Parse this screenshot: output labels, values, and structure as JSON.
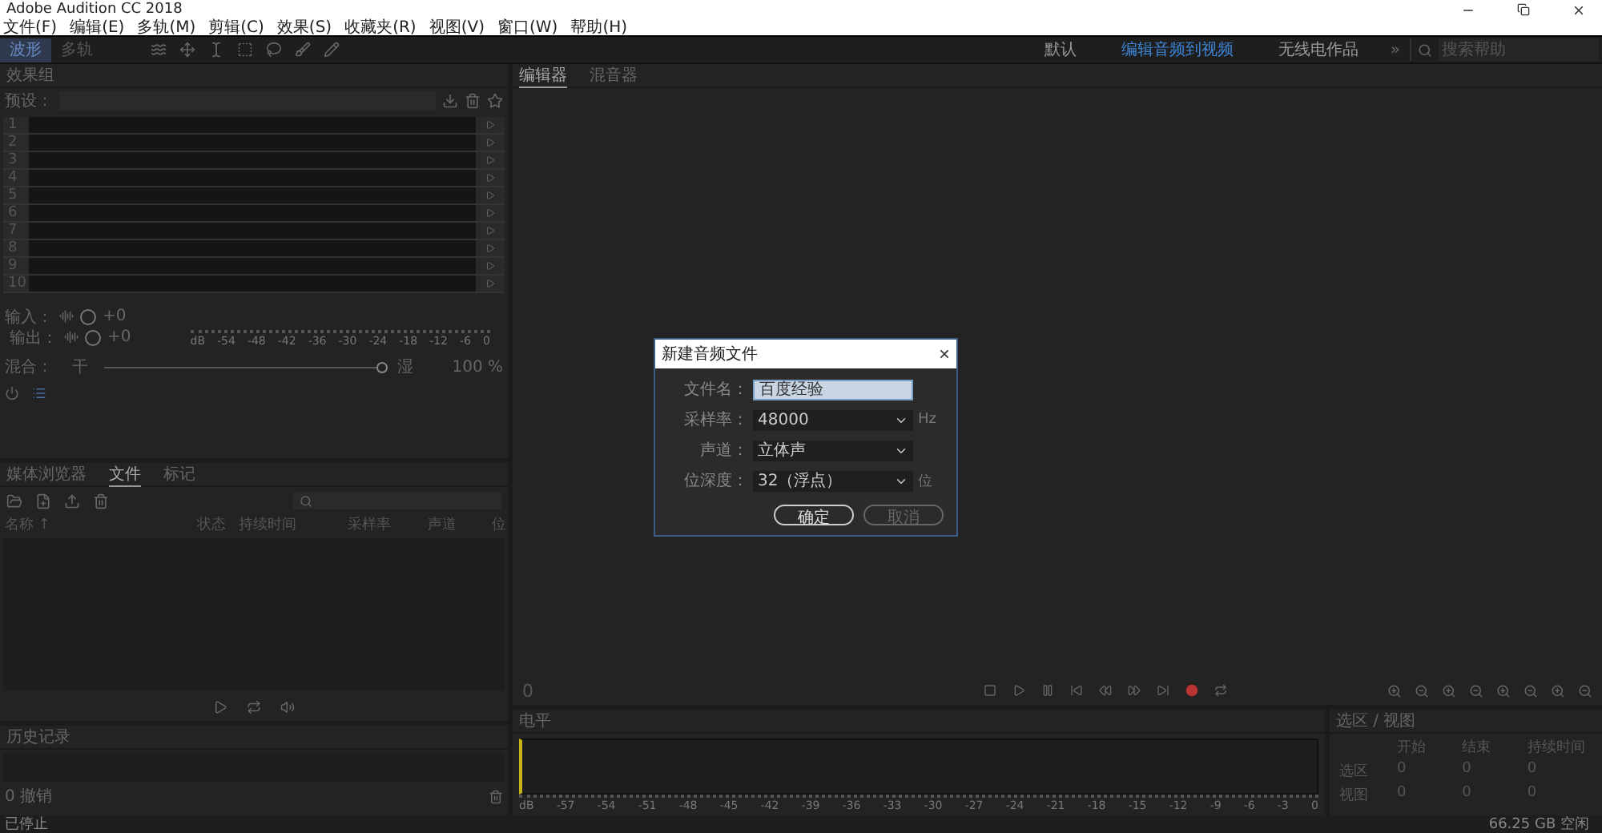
{
  "window": {
    "title": "Adobe Audition CC 2018"
  },
  "menu": [
    "文件(F)",
    "编辑(E)",
    "多轨(M)",
    "剪辑(C)",
    "效果(S)",
    "收藏夹(R)",
    "视图(V)",
    "窗口(W)",
    "帮助(H)"
  ],
  "toolbar": {
    "modes": [
      {
        "label": "波形",
        "selected": true
      },
      {
        "label": "多轨",
        "selected": false
      }
    ]
  },
  "workspaces": [
    {
      "label": "默认",
      "selected": false
    },
    {
      "label": "编辑音频到视频",
      "selected": true
    },
    {
      "label": "无线电作品",
      "selected": false
    }
  ],
  "overflow": "»",
  "help_search": {
    "placeholder": "搜索帮助"
  },
  "effects_rack": {
    "title": "效果组",
    "preset_label": "预设：",
    "slots": [
      "1",
      "2",
      "3",
      "4",
      "5",
      "6",
      "7",
      "8",
      "9",
      "10"
    ],
    "input": {
      "label": "输入：",
      "value": "+0"
    },
    "output": {
      "label": "输出：",
      "value": "+0"
    },
    "db_scale": [
      "dB",
      "-54",
      "-48",
      "-42",
      "-36",
      "-30",
      "-24",
      "-18",
      "-12",
      "-6",
      "0"
    ],
    "mix": {
      "label": "混合：",
      "dry": "干",
      "wet": "湿",
      "level": 1,
      "value": "100 %"
    }
  },
  "files_panel": {
    "tabs": [
      {
        "label": "媒体浏览器",
        "selected": false
      },
      {
        "label": "文件",
        "selected": true
      },
      {
        "label": "标记",
        "selected": false
      }
    ],
    "columns": [
      "名称 ↑",
      "状态",
      "持续时间",
      "采样率",
      "声道",
      "位"
    ]
  },
  "history": {
    "title": "历史记录",
    "undo": "0 撤销"
  },
  "editor": {
    "tabs": [
      {
        "label": "编辑器",
        "selected": true
      },
      {
        "label": "混音器",
        "selected": false
      }
    ],
    "time": "0"
  },
  "dialog": {
    "title": "新建音频文件",
    "close": "×",
    "fields": [
      {
        "kind": "text",
        "label": "文件名：",
        "value": "百度经验"
      },
      {
        "kind": "select",
        "label": "采样率：",
        "value": "48000",
        "unit": "Hz"
      },
      {
        "kind": "select",
        "label": "声道：",
        "value": "立体声"
      },
      {
        "kind": "select",
        "label": "位深度：",
        "value": "32（浮点）",
        "unit": "位"
      }
    ],
    "buttons": [
      {
        "label": "确定",
        "primary": true
      },
      {
        "label": "取消",
        "primary": false
      }
    ]
  },
  "levels": {
    "title": "电平",
    "scale": [
      "dB",
      "-57",
      "-54",
      "-51",
      "-48",
      "-45",
      "-42",
      "-39",
      "-36",
      "-33",
      "-30",
      "-27",
      "-24",
      "-21",
      "-18",
      "-15",
      "-12",
      "-9",
      "-6",
      "-3",
      "0"
    ]
  },
  "selection_view": {
    "title": "选区 / 视图",
    "columns": [
      "开始",
      "结束",
      "持续时间"
    ],
    "rows": [
      {
        "label": "选区",
        "values": [
          "0",
          "0",
          "0"
        ]
      },
      {
        "label": "视图",
        "values": [
          "0",
          "0",
          "0"
        ]
      }
    ]
  },
  "status_bar": {
    "left": "已停止",
    "right": "66.25 GB 空闲"
  }
}
